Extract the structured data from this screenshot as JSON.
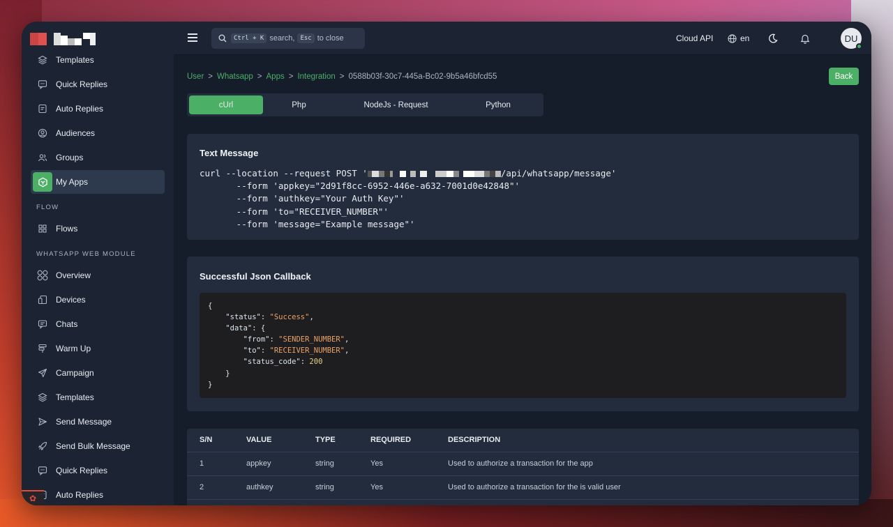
{
  "sidebar": {
    "items_top": [
      {
        "label": "Templates",
        "icon": "layers-icon"
      },
      {
        "label": "Quick Replies",
        "icon": "message-reply-icon"
      },
      {
        "label": "Auto Replies",
        "icon": "message-auto-icon"
      },
      {
        "label": "Audiences",
        "icon": "user-circle-icon"
      },
      {
        "label": "Groups",
        "icon": "users-icon"
      },
      {
        "label": "My Apps",
        "icon": "apps-icon",
        "active": true
      }
    ],
    "section_flow": "FLOW",
    "flow_items": [
      {
        "label": "Flows",
        "icon": "grid-icon"
      }
    ],
    "section_web": "WHATSAPP WEB MODULE",
    "web_items": [
      {
        "label": "Overview",
        "icon": "overview-icon"
      },
      {
        "label": "Devices",
        "icon": "devices-icon"
      },
      {
        "label": "Chats",
        "icon": "chat-icon"
      },
      {
        "label": "Warm Up",
        "icon": "warmup-icon"
      },
      {
        "label": "Campaign",
        "icon": "send-icon"
      },
      {
        "label": "Templates",
        "icon": "layers-icon"
      },
      {
        "label": "Send Message",
        "icon": "send-message-icon"
      },
      {
        "label": "Send Bulk Message",
        "icon": "rocket-icon"
      },
      {
        "label": "Quick Replies",
        "icon": "message-reply-icon"
      },
      {
        "label": "Auto Replies",
        "icon": "message-auto-icon"
      }
    ]
  },
  "topbar": {
    "search_shortcut": "Ctrl + K",
    "search_text": "search,",
    "esc_key": "Esc",
    "close_text": "to close",
    "cloud_api": "Cloud API",
    "language": "en",
    "avatar_initials": "DU"
  },
  "breadcrumb": {
    "user": "User",
    "whatsapp": "Whatsapp",
    "apps": "Apps",
    "integration": "Integration",
    "current": "0588b03f-30c7-445a-Bc02-9b5a46bfcd55",
    "sep": ">"
  },
  "back_label": "Back",
  "tabs": [
    "cUrl",
    "Php",
    "NodeJs - Request",
    "Python"
  ],
  "text_message": {
    "title": "Text Message",
    "line1_pre": "curl --location --request POST '",
    "line1_post": "/api/whatsapp/message'",
    "line2": "       --form 'appkey=\"2d91f8cc-6952-446e-a632-7001d0e42848\"'",
    "line3": "       --form 'authkey=\"Your Auth Key\"'",
    "line4": "       --form 'to=\"RECEIVER_NUMBER\"'",
    "line5": "       --form 'message=\"Example message\"'"
  },
  "callback": {
    "title": "Successful Json Callback",
    "status_key": "\"status\"",
    "status_val": "\"Success\"",
    "data_key": "\"data\"",
    "from_key": "\"from\"",
    "from_val": "\"SENDER_NUMBER\"",
    "to_key": "\"to\"",
    "to_val": "\"RECEIVER_NUMBER\"",
    "code_key": "\"status_code\"",
    "code_val": "200"
  },
  "table": {
    "headers": [
      "S/N",
      "VALUE",
      "TYPE",
      "REQUIRED",
      "DESCRIPTION"
    ],
    "rows": [
      [
        "1",
        "appkey",
        "string",
        "Yes",
        "Used to authorize a transaction for the app"
      ],
      [
        "2",
        "authkey",
        "string",
        "Yes",
        "Used to authorize a transaction for the is valid user"
      ]
    ]
  },
  "colors": {
    "accent": "#4caf66",
    "panel": "#222c3c",
    "sidebar": "#1c2433",
    "background": "#151d2b"
  }
}
